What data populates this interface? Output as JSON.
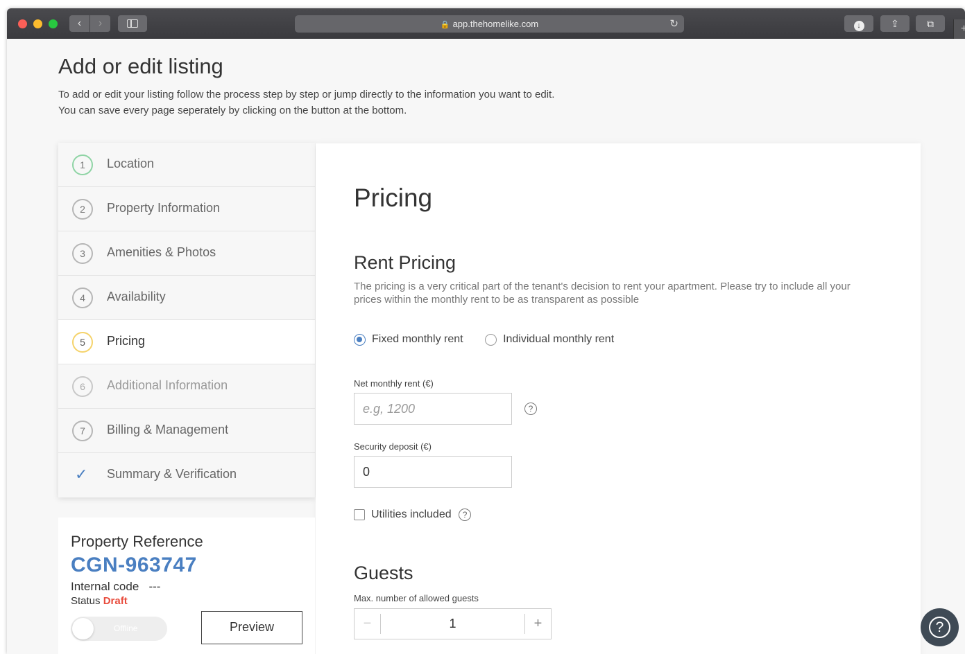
{
  "browser": {
    "url": "app.thehomelike.com",
    "lock_icon": "🔒",
    "reload_icon": "↻",
    "back_icon": "‹",
    "forward_icon": "›",
    "download_icon": "↓",
    "share_icon": "⇪",
    "tabs_icon": "⧉",
    "new_tab_icon": "+"
  },
  "page": {
    "title": "Add or edit listing",
    "description": "To add or edit your listing follow the process step by step or jump directly to the information you want to edit. You can save every page seperately by clicking on the button at the bottom."
  },
  "steps": [
    {
      "num": "1",
      "label": "Location",
      "state": "done"
    },
    {
      "num": "2",
      "label": "Property Information",
      "state": "normal"
    },
    {
      "num": "3",
      "label": "Amenities & Photos",
      "state": "normal"
    },
    {
      "num": "4",
      "label": "Availability",
      "state": "normal"
    },
    {
      "num": "5",
      "label": "Pricing",
      "state": "active"
    },
    {
      "num": "6",
      "label": "Additional Information",
      "state": "disabled"
    },
    {
      "num": "7",
      "label": "Billing & Management",
      "state": "normal"
    },
    {
      "num": "✓",
      "label": "Summary & Verification",
      "state": "check"
    }
  ],
  "pricing": {
    "title": "Pricing",
    "rent_section_title": "Rent Pricing",
    "rent_section_desc": "The pricing is a very critical part of the tenant's decision to rent your apartment. Please try to include all your prices within the monthly rent to be as transparent as possible",
    "radio_fixed": "Fixed monthly rent",
    "radio_individual": "Individual monthly rent",
    "net_rent_label": "Net monthly rent (€)",
    "net_rent_placeholder": "e.g, 1200",
    "net_rent_value": "",
    "deposit_label": "Security deposit (€)",
    "deposit_value": "0",
    "utilities_label": "Utilities included",
    "help_icon": "?",
    "guests_title": "Guests",
    "guests_label": "Max. number of allowed guests",
    "guests_value": "1",
    "minus_icon": "−",
    "plus_icon": "+"
  },
  "reference": {
    "title": "Property Reference",
    "code": "CGN-963747",
    "internal_label": "Internal code",
    "internal_value": "---",
    "status_label": "Status",
    "status_value": "Draft",
    "toggle_label": "Offline",
    "preview_label": "Preview"
  },
  "help_fab_icon": "?"
}
